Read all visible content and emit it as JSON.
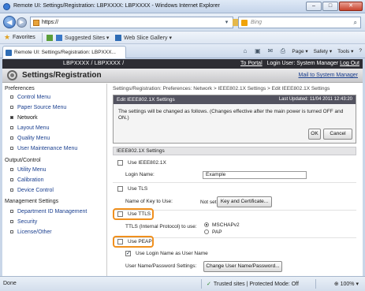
{
  "window": {
    "title": "Remote UI: Settings/Registration: LBPXXXX: LBPXXXX - Windows Internet Explorer",
    "minimize": "–",
    "maximize": "□",
    "close": "✕"
  },
  "address": {
    "url": "https://",
    "search_placeholder": "Bing"
  },
  "favorites": {
    "label": "Favorites",
    "suggested_sites": "Suggested Sites ▾",
    "web_slice_gallery": "Web Slice Gallery ▾"
  },
  "tab": {
    "label": "Remote UI: Settings/Registration: LBPXXX..."
  },
  "commandbar": {
    "page": "Page ▾",
    "safety": "Safety ▾",
    "tools": "Tools ▾",
    "help": "?"
  },
  "header": {
    "device": "LBPXXXX / LBPXXXX /",
    "to_portal": "To Portal",
    "login_user": "Login User: System Manager",
    "log_out": "Log Out",
    "app_title": "Settings/Registration",
    "mail_link": "Mail to System Manager"
  },
  "sidebar": {
    "groups": [
      {
        "label": "Preferences",
        "items": [
          "Control Menu",
          "Paper Source Menu",
          "Network",
          "Layout Menu",
          "Quality Menu",
          "User Maintenance Menu"
        ]
      },
      {
        "label": "Output/Control",
        "items": [
          "Utility Menu",
          "Calibration",
          "Device Control"
        ]
      },
      {
        "label": "Management Settings",
        "items": [
          "Department ID Management",
          "Security",
          "License/Other"
        ]
      }
    ],
    "active_item": "Network"
  },
  "main": {
    "breadcrumb": "Settings/Registration: Preferences: Network > IEEE802.1X Settings > Edit IEEE802.1X Settings",
    "edit_title": "Edit IEEE802.1X Settings",
    "last_updated": "Last Updated: 11/04 2011 12:43:20",
    "message": "The settings will be changed as follows. (Changes effective after the main power is turned OFF and ON.)",
    "ok": "OK",
    "cancel": "Cancel",
    "section_title": "IEEE802.1X Settings",
    "use_ieee": "Use IEEE802.1X",
    "login_name_label": "Login Name:",
    "login_name_value": "Example",
    "use_tls": "Use TLS",
    "key_label": "Name of Key to Use:",
    "key_value": "Not set",
    "key_button": "Key and Certificate...",
    "use_ttls": "Use TTLS",
    "ttls_protocol_label": "TTLS (Internal Protocol) to use:",
    "mschapv2": "MSCHAPv2",
    "pap": "PAP",
    "use_peap": "Use PEAP",
    "use_login_name": "Use Login Name as User Name",
    "user_settings_label": "User Name/Password Settings:",
    "change_button": "Change User Name/Password..."
  },
  "statusbar": {
    "left": "Done",
    "zone": "Trusted sites | Protected Mode: Off",
    "zoom": "100% ▾"
  }
}
